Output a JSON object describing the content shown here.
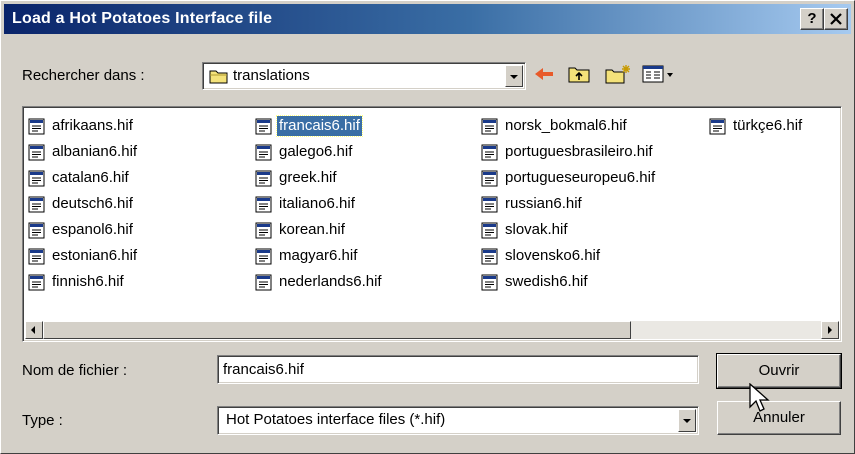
{
  "window": {
    "title": "Load a Hot Potatoes Interface file",
    "help_label": "?",
    "close_label": "×"
  },
  "look_in": {
    "label": "Rechercher dans :",
    "value": "translations",
    "icon": "folder-icon"
  },
  "toolbar": {
    "back_icon": "back-arrow-icon",
    "up_icon": "up-folder-icon",
    "new_folder_icon": "new-folder-icon",
    "view_menu_icon": "view-menu-icon"
  },
  "files": {
    "items": [
      {
        "name": "afrikaans.hif"
      },
      {
        "name": "albanian6.hif"
      },
      {
        "name": "catalan6.hif"
      },
      {
        "name": "deutsch6.hif"
      },
      {
        "name": "espanol6.hif"
      },
      {
        "name": "estonian6.hif"
      },
      {
        "name": "finnish6.hif"
      },
      {
        "name": "francais6.hif",
        "selected": true
      },
      {
        "name": "galego6.hif"
      },
      {
        "name": "greek.hif"
      },
      {
        "name": "italiano6.hif"
      },
      {
        "name": "korean.hif"
      },
      {
        "name": "magyar6.hif"
      },
      {
        "name": "nederlands6.hif"
      },
      {
        "name": "norsk_bokmal6.hif"
      },
      {
        "name": "portuguesbrasileiro.hif"
      },
      {
        "name": "portugueseuropeu6.hif"
      },
      {
        "name": "russian6.hif"
      },
      {
        "name": "slovak.hif"
      },
      {
        "name": "slovensko6.hif"
      },
      {
        "name": "swedish6.hif"
      },
      {
        "name": "türkçe6.hif"
      }
    ],
    "file_icon": "hif-file-icon"
  },
  "filename": {
    "label": "Nom de fichier :",
    "value": "francais6.hif"
  },
  "filetype": {
    "label": "Type :",
    "value": "Hot Potatoes interface files (*.hif)"
  },
  "buttons": {
    "open": "Ouvrir",
    "cancel": "Annuler"
  },
  "colors": {
    "title_start": "#0a246a",
    "title_end": "#a6caf0",
    "selection": "#3a6ea5",
    "face": "#d4d0c8"
  }
}
